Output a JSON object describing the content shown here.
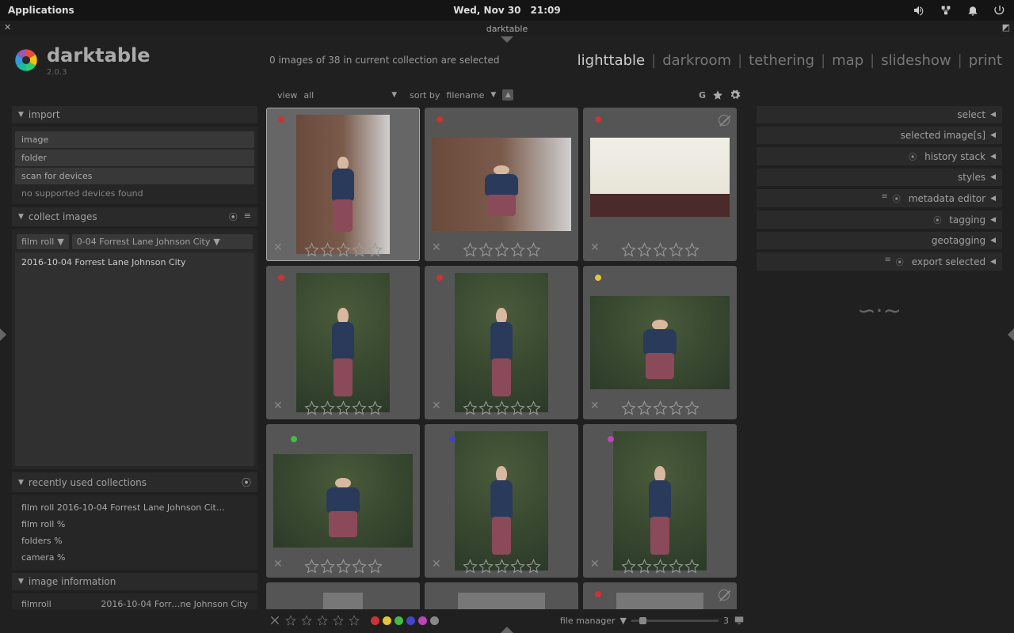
{
  "system": {
    "app_menu": "Applications",
    "date": "Wed, Nov 30",
    "time": "21:09"
  },
  "window": {
    "title": "darktable"
  },
  "app": {
    "name": "darktable",
    "version": "2.0.3",
    "status": "0 images of 38 in current collection are selected"
  },
  "modes": [
    "lighttable",
    "darkroom",
    "tethering",
    "map",
    "slideshow",
    "print"
  ],
  "active_mode": "lighttable",
  "filterbar": {
    "view_label": "view",
    "view_value": "all",
    "sort_label": "sort by",
    "sort_value": "filename",
    "group_icon": "G"
  },
  "left": {
    "import": {
      "title": "import",
      "items": [
        "image",
        "folder",
        "scan for devices"
      ],
      "note": "no supported devices found"
    },
    "collect": {
      "title": "collect images",
      "rule_type": "film roll",
      "rule_value": "0-04 Forrest Lane Johnson City",
      "list_item": "2016-10-04 Forrest Lane Johnson City"
    },
    "recent": {
      "title": "recently used collections",
      "items": [
        "film roll 2016-10-04 Forrest Lane Johnson Cit…",
        "film roll %",
        "folders %",
        "camera %"
      ]
    },
    "info": {
      "title": "image information",
      "filmroll_label": "filmroll",
      "filmroll_value": "2016-10-04 Forr…ne Johnson City"
    }
  },
  "right": {
    "panels": [
      "select",
      "selected image[s]",
      "history stack",
      "styles",
      "metadata editor",
      "tagging",
      "geotagging",
      "export selected"
    ]
  },
  "grid": {
    "thumbs": [
      {
        "orient": "portrait",
        "color": "#cc3333",
        "bg": "brick",
        "sel": true
      },
      {
        "orient": "landscape",
        "color": "#cc3333",
        "bg": "brick"
      },
      {
        "orient": "landscape",
        "color": "#cc3333",
        "bg": "sunset",
        "altmark": true
      },
      {
        "orient": "portrait",
        "color": "#cc3333",
        "bg": "green"
      },
      {
        "orient": "portrait",
        "color": "#cc3333",
        "bg": "green"
      },
      {
        "orient": "landscape",
        "color": "#e0c838",
        "bg": "green"
      },
      {
        "orient": "landscape",
        "color": "#44bb44",
        "bg": "green",
        "inner": true
      },
      {
        "orient": "portrait",
        "color": "#4444bb",
        "bg": "green",
        "inner": true
      },
      {
        "orient": "portrait",
        "color": "#bb44bb",
        "bg": "green",
        "inner": true
      }
    ]
  },
  "bottombar": {
    "layout_label": "file manager",
    "zoom_value": "3",
    "color_dots": [
      "#cc3333",
      "#e0c838",
      "#44bb44",
      "#4444cc",
      "#bb44bb",
      "#888888"
    ]
  }
}
